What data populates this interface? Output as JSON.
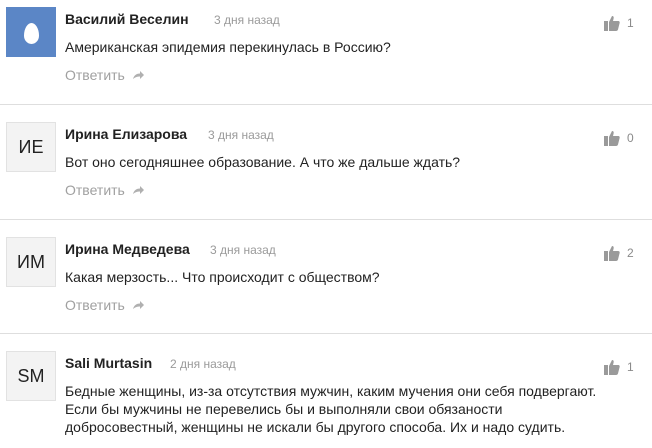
{
  "reply_label": "Ответить",
  "comments": [
    {
      "author": "Василий Веселин",
      "time": "3 дня назад",
      "avatar": "egg-icon",
      "text": "Американская эпидемия перекинулась в Россию?",
      "likes": "1"
    },
    {
      "author": "Ирина Елизарова",
      "time": "3 дня назад",
      "avatar": "ИЕ",
      "text": "Вот оно сегодняшнее образование. А что же дальше ждать?",
      "likes": "0"
    },
    {
      "author": "Ирина Медведева",
      "time": "3 дня назад",
      "avatar": "ИМ",
      "text": "Какая мерзость... Что происходит с обществом?",
      "likes": "2"
    },
    {
      "author": "Sali Murtasin",
      "time": "2 дня назад",
      "avatar": "SM",
      "text_lines": [
        "Бедные женщины, из-за отсутствия мужчин, каким мучения они себя подвергают.",
        "Если бы мужчины не перевелись бы и выполняли свои обязаности",
        "добросовестный, женщины не искали бы другого способа. Их и надо судить."
      ],
      "likes": "1"
    }
  ]
}
